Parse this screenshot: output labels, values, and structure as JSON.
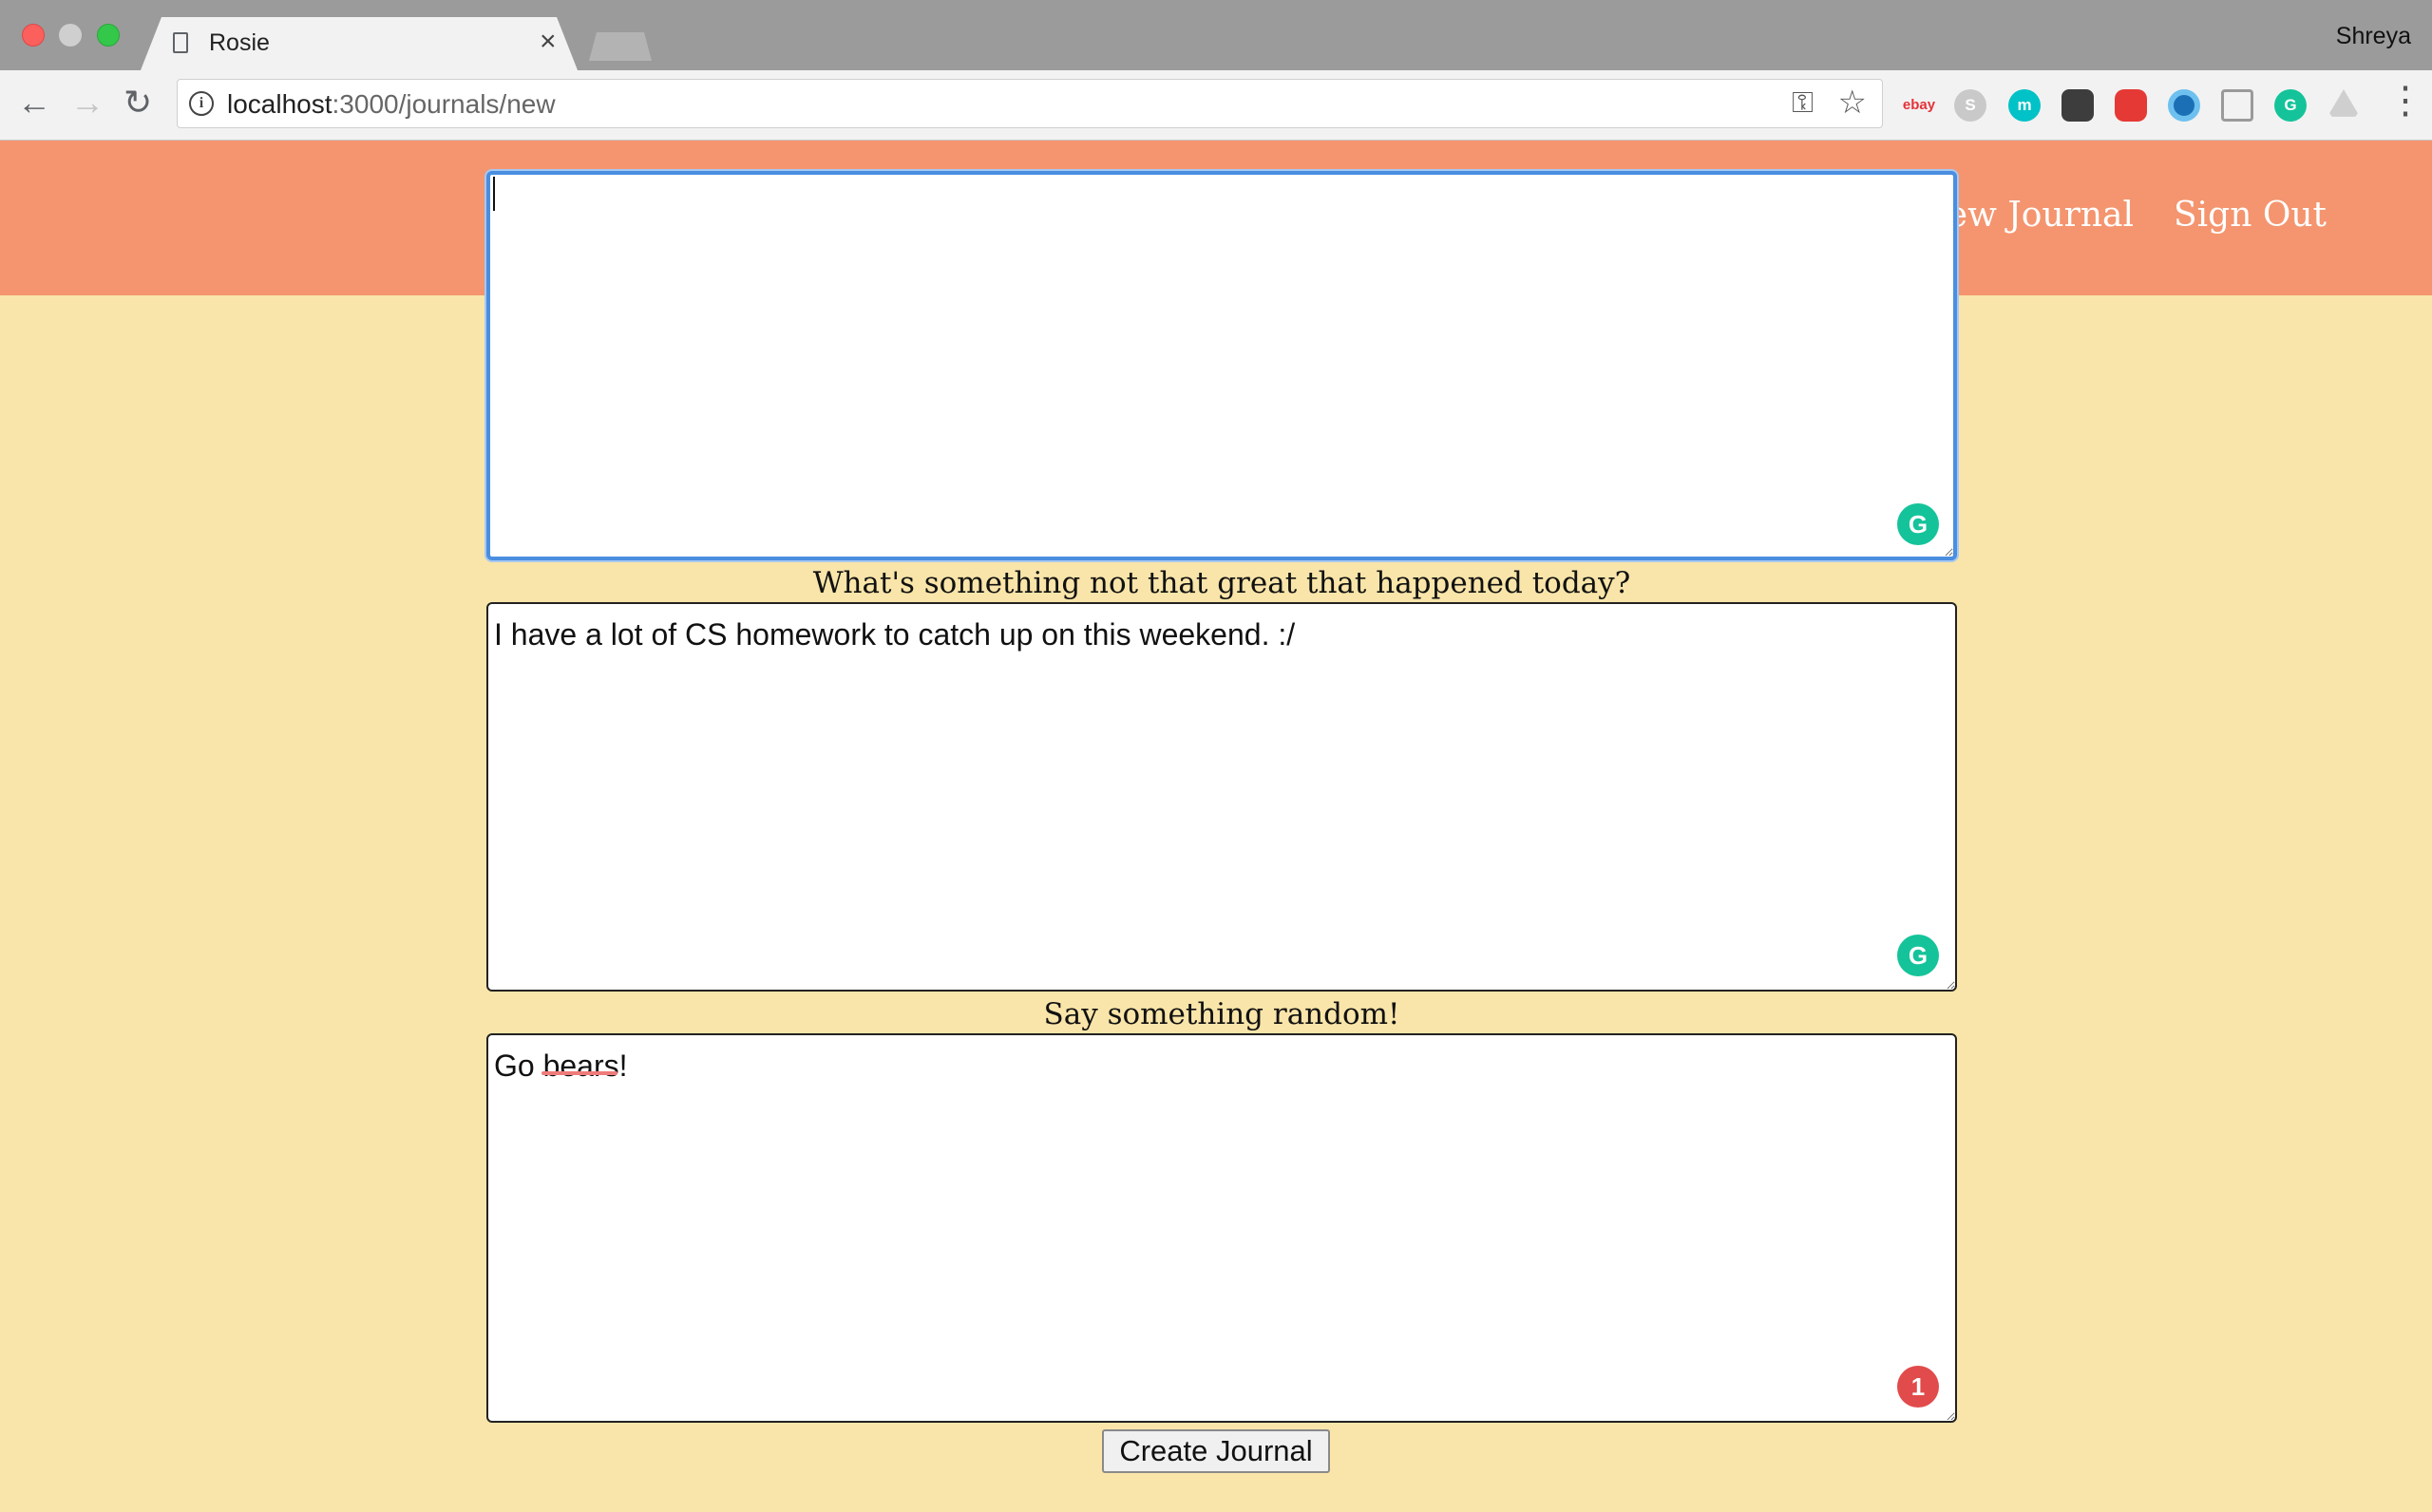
{
  "browser": {
    "tab_title": "Rosie",
    "tab_close": "×",
    "profile_name": "Shreya",
    "url_host": "localhost",
    "url_path": ":3000/journals/new",
    "back_glyph": "←",
    "forward_glyph": "→",
    "reload_glyph": "↻",
    "info_glyph": "i",
    "key_glyph": "⚿",
    "star_glyph": "☆",
    "menu_glyph": "⋮",
    "extensions": [
      {
        "name": "ebay-icon",
        "label": "ebay"
      },
      {
        "name": "skype-icon",
        "label": "S"
      },
      {
        "name": "m-icon",
        "label": "m"
      },
      {
        "name": "evernote-icon",
        "label": ""
      },
      {
        "name": "adblock-icon",
        "label": ""
      },
      {
        "name": "eye-icon",
        "label": ""
      },
      {
        "name": "paint-bucket-icon",
        "label": ""
      },
      {
        "name": "grammarly-extension-icon",
        "label": "G"
      },
      {
        "name": "drive-icon",
        "label": ""
      }
    ]
  },
  "nav": {
    "new_journal_label": "New Journal",
    "sign_out_label": "Sign Out"
  },
  "form": {
    "fields": [
      {
        "prompt": "",
        "value": ""
      },
      {
        "prompt": "What's something not that great that happened today?",
        "value": "I have a lot of CS homework to catch up on this weekend. :/"
      },
      {
        "prompt": "Say something random!",
        "value": "Go bears!"
      }
    ],
    "grammarly_badge": "G",
    "error_count": "1",
    "submit_label": "Create Journal"
  },
  "colors": {
    "page_background": "#f9e5a9",
    "navbar": "#f4956f",
    "grammarly_green": "#15c39a",
    "error_red": "#e14b4b"
  }
}
